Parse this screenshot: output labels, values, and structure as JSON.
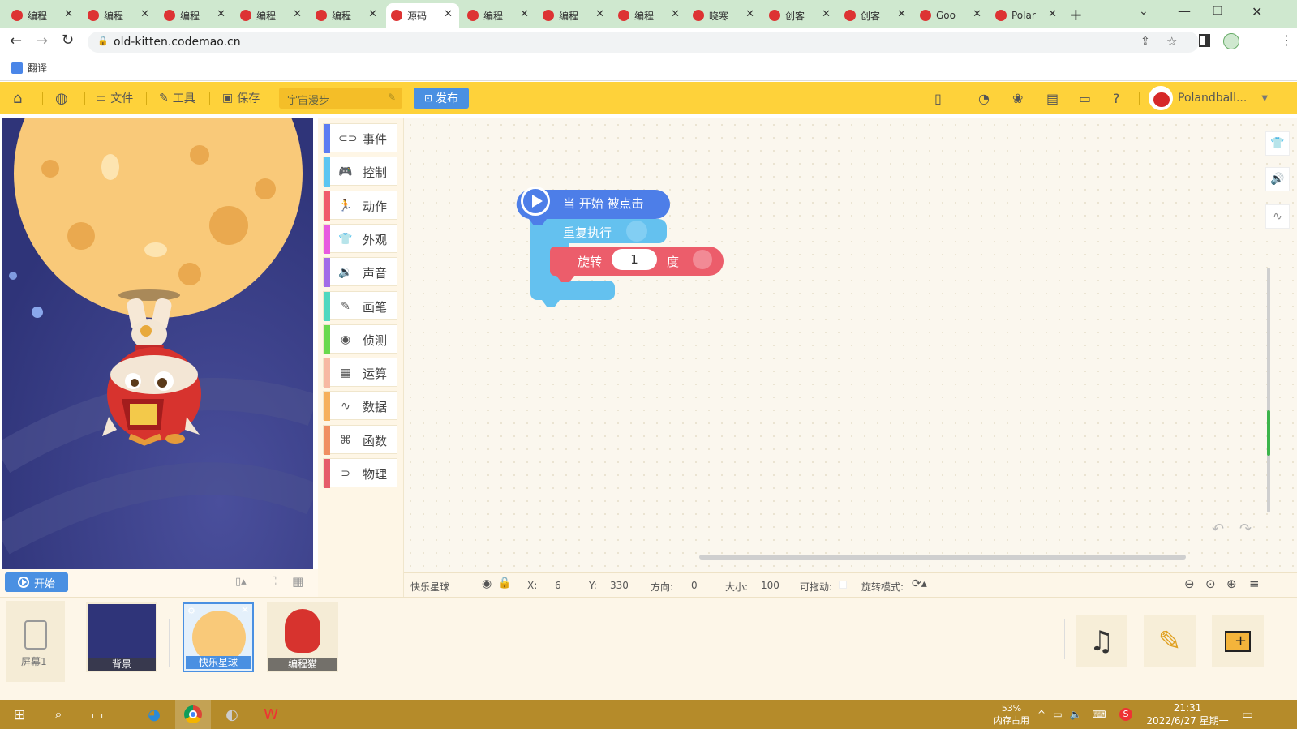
{
  "browser": {
    "tabs": [
      {
        "label": "编程",
        "active": false
      },
      {
        "label": "编程",
        "active": false
      },
      {
        "label": "编程",
        "active": false
      },
      {
        "label": "编程",
        "active": false
      },
      {
        "label": "编程",
        "active": false
      },
      {
        "label": "源码",
        "active": true
      },
      {
        "label": "编程",
        "active": false
      },
      {
        "label": "编程",
        "active": false
      },
      {
        "label": "编程",
        "active": false
      },
      {
        "label": "晓寒",
        "active": false
      },
      {
        "label": "创客",
        "active": false
      },
      {
        "label": "创客",
        "active": false
      },
      {
        "label": "Goo",
        "active": false
      },
      {
        "label": "Polar",
        "active": false
      }
    ],
    "url": "old-kitten.codemao.cn",
    "bookmark_translate": "翻译"
  },
  "toolbar": {
    "file": "文件",
    "tools": "工具",
    "save": "保存",
    "project_title": "宇宙漫步",
    "publish": "发布",
    "username": "Polandball..."
  },
  "stage": {
    "start_button": "开始"
  },
  "categories": [
    {
      "label": "事件",
      "color": "#5b7cf2",
      "icon": "eye-shape-icon"
    },
    {
      "label": "控制",
      "color": "#5bc6f2",
      "icon": "gamepad-icon"
    },
    {
      "label": "动作",
      "color": "#f05a6b",
      "icon": "running-icon"
    },
    {
      "label": "外观",
      "color": "#e859e0",
      "icon": "shirt-icon"
    },
    {
      "label": "声音",
      "color": "#a26be8",
      "icon": "speaker-icon"
    },
    {
      "label": "画笔",
      "color": "#4fd8c0",
      "icon": "pencil-icon"
    },
    {
      "label": "侦测",
      "color": "#69d94d",
      "icon": "radar-icon"
    },
    {
      "label": "运算",
      "color": "#f7b9a3",
      "icon": "calculator-icon"
    },
    {
      "label": "数据",
      "color": "#f6b05c",
      "icon": "chart-line-icon"
    },
    {
      "label": "函数",
      "color": "#f08f62",
      "icon": "code-icon"
    },
    {
      "label": "物理",
      "color": "#e65c6b",
      "icon": "magnet-icon"
    }
  ],
  "blocks": {
    "hat": "当 开始 被点击",
    "loop": "重复执行",
    "rotate_prefix": "旋转",
    "rotate_value": "1",
    "rotate_suffix": "度"
  },
  "properties": {
    "sprite_name": "快乐星球",
    "x_label": "X:",
    "x_value": "6",
    "y_label": "Y:",
    "y_value": "330",
    "direction_label": "方向:",
    "direction_value": "0",
    "size_label": "大小:",
    "size_value": "100",
    "draggable_label": "可拖动:",
    "rotation_mode_label": "旋转模式:"
  },
  "assets": {
    "screen_label": "屏幕1",
    "items": [
      {
        "label": "背景"
      },
      {
        "label": "快乐星球"
      },
      {
        "label": "编程猫"
      }
    ]
  },
  "taskbar": {
    "memory_percent": "53%",
    "memory_label": "内存占用",
    "time": "21:31",
    "date": "2022/6/27 星期一"
  }
}
